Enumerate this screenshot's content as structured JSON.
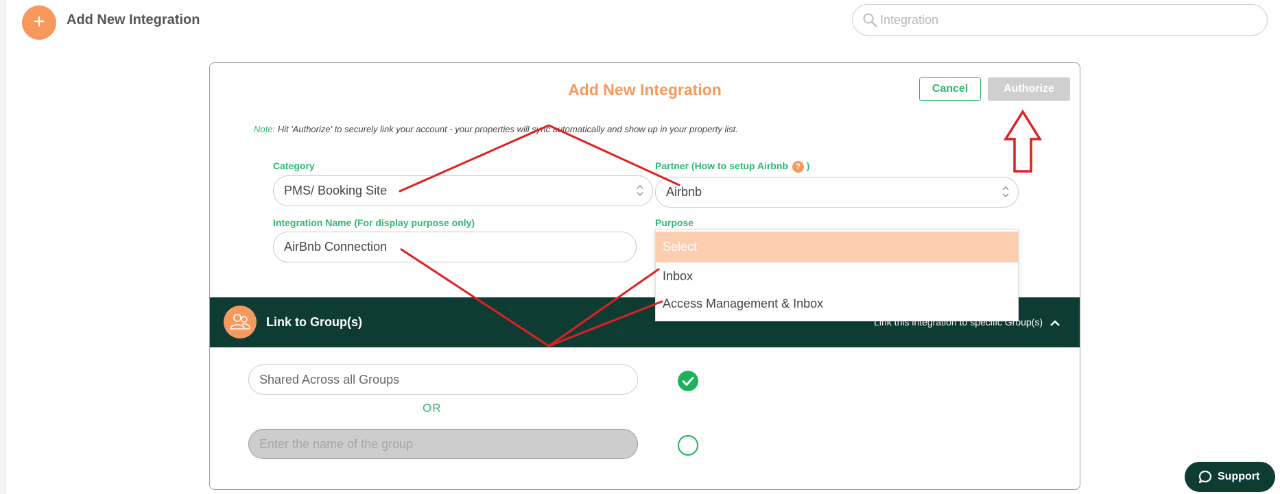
{
  "header": {
    "add_icon": "plus-icon",
    "title": "Add New Integration",
    "search_placeholder": "Integration",
    "search_icon": "search-icon"
  },
  "dialog": {
    "title": "Add New Integration",
    "cancel_label": "Cancel",
    "authorize_label": "Authorize",
    "note_label": "Note:",
    "note_text": "Hit 'Authorize' to securely link your account - your properties will sync automatically and show up in your property list.",
    "category_label": "Category",
    "category_value": "PMS/ Booking Site",
    "partner_label": "Partner (How to setup Airbnb",
    "partner_help": "?",
    "partner_close": ")",
    "partner_value": "Airbnb",
    "name_label": "Integration Name (For display purpose only)",
    "name_value": "AirBnb Connection",
    "purpose_label": "Purpose",
    "purpose_options": [
      "Select",
      "Inbox",
      "Access Management & Inbox"
    ]
  },
  "groups": {
    "title": "Link to Group(s)",
    "hint": "Link this integration to specific Group(s)",
    "shared_label": "Shared Across all Groups",
    "or_label": "OR",
    "group_placeholder": "Enter the name of the group"
  },
  "support": {
    "label": "Support",
    "icon": "chat-bubble-icon"
  },
  "colors": {
    "accent_orange": "#f7995c",
    "accent_green": "#2eb872",
    "dark_green": "#0e3c33",
    "annotation_red": "#e02020",
    "selected_option": "#fdcdb0"
  }
}
